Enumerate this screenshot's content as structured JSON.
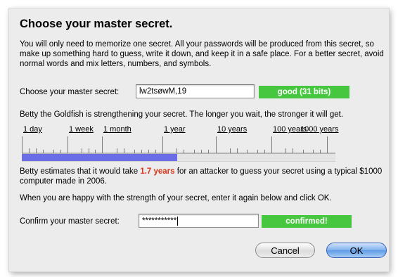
{
  "dialog": {
    "title": "Choose your master secret.",
    "intro": "You will only need to memorize one secret. All your passwords will be produced from this secret, so make up something hard to guess, write it down, and keep it in a safe place. For a better secret, avoid normal words and mix letters, numbers, and symbols."
  },
  "secret": {
    "label": "Choose your master secret:",
    "value": "lw2tsøwM,19",
    "strength_label": "good (31 bits)",
    "strength_color": "#47c640"
  },
  "goldfish": {
    "message": "Betty the Goldfish is strengthening your secret. The longer you wait, the stronger it will get."
  },
  "timescale": {
    "labels": [
      "1 day",
      "1 week",
      "1 month",
      "1 year",
      "10 years",
      "100 years",
      "1000 years"
    ],
    "progress_fraction": 0.495,
    "fill_color": "#6a6de6"
  },
  "estimate": {
    "prefix": "Betty estimates that it would take ",
    "duration": "1.7 years",
    "suffix": " for an attacker to guess your secret using a typical $1000 computer made in 2006.",
    "highlight_color": "#d8351b"
  },
  "confirm": {
    "instruction": "When you are happy with the strength of your secret, enter it again below and click OK.",
    "label": "Confirm your master secret:",
    "value": "***********",
    "status_label": "confirmed!"
  },
  "buttons": {
    "cancel": "Cancel",
    "ok": "OK"
  }
}
